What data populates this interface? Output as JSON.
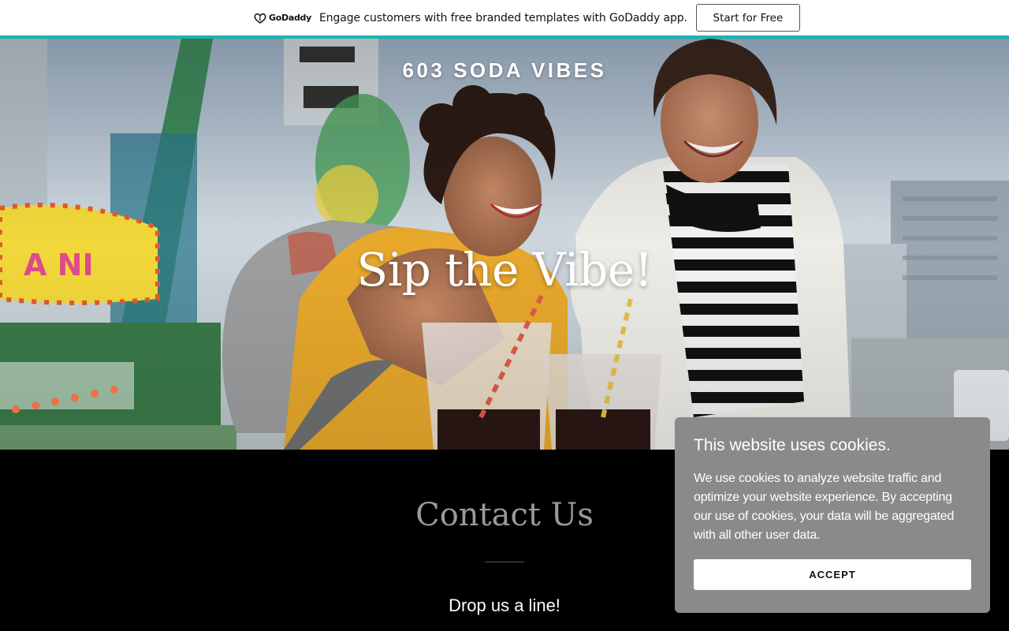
{
  "promo": {
    "brand": "GoDaddy",
    "text": "Engage customers with free branded templates with GoDaddy app.",
    "button": "Start for Free",
    "accent_color": "#1bb3b1"
  },
  "hero": {
    "site_title": "603 SODA VIBES",
    "heading": "Sip the Vibe!"
  },
  "contact": {
    "title": "Contact Us",
    "subtitle": "Drop us a line!"
  },
  "cookie": {
    "title": "This website uses cookies.",
    "body": "We use cookies to analyze website traffic and optimize your website experience. By accepting our use of cookies, your data will be aggregated with all other user data.",
    "accept": "ACCEPT"
  }
}
